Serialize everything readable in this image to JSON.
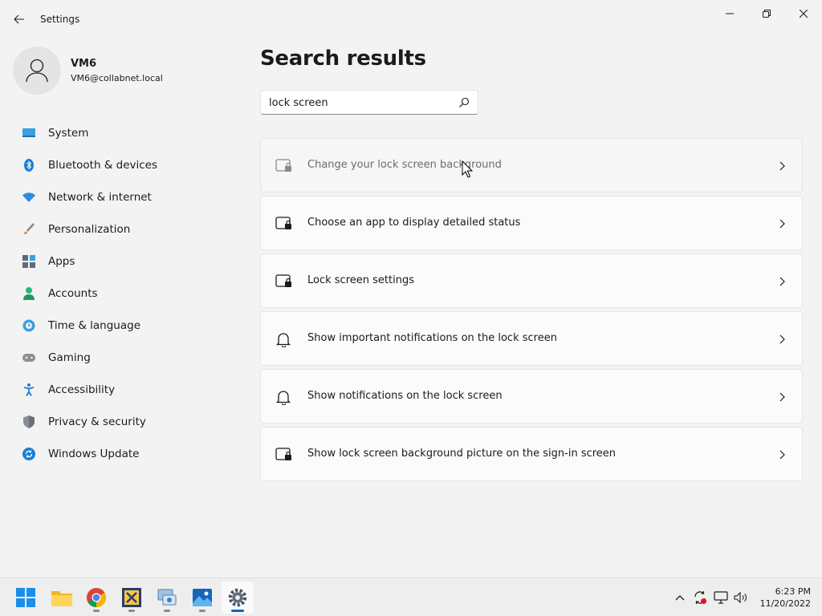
{
  "window": {
    "title": "Settings"
  },
  "profile": {
    "name": "VM6",
    "email": "VM6@collabnet.local"
  },
  "sidebar": {
    "items": [
      {
        "label": "System",
        "icon": "system-icon"
      },
      {
        "label": "Bluetooth & devices",
        "icon": "bluetooth-icon"
      },
      {
        "label": "Network & internet",
        "icon": "wifi-icon"
      },
      {
        "label": "Personalization",
        "icon": "brush-icon"
      },
      {
        "label": "Apps",
        "icon": "apps-icon"
      },
      {
        "label": "Accounts",
        "icon": "accounts-icon"
      },
      {
        "label": "Time & language",
        "icon": "clock-globe-icon"
      },
      {
        "label": "Gaming",
        "icon": "gamepad-icon"
      },
      {
        "label": "Accessibility",
        "icon": "accessibility-icon"
      },
      {
        "label": "Privacy & security",
        "icon": "shield-icon"
      },
      {
        "label": "Windows Update",
        "icon": "update-icon"
      }
    ]
  },
  "main": {
    "title": "Search results",
    "search": {
      "value": "lock screen"
    },
    "results": [
      {
        "label": "Change your lock screen background",
        "icon": "lock-screen-icon"
      },
      {
        "label": "Choose an app to display detailed status",
        "icon": "lock-screen-icon"
      },
      {
        "label": "Lock screen settings",
        "icon": "lock-screen-icon"
      },
      {
        "label": "Show important notifications on the lock screen",
        "icon": "bell-icon"
      },
      {
        "label": "Show notifications on the lock screen",
        "icon": "bell-icon"
      },
      {
        "label": "Show lock screen background picture on the sign-in screen",
        "icon": "lock-screen-icon"
      }
    ]
  },
  "taskbar": {
    "apps": [
      "start-icon",
      "file-explorer-icon",
      "chrome-icon",
      "visual-studio-icon",
      "remote-desktop-icon",
      "photos-icon",
      "settings-icon"
    ],
    "clock": {
      "time": "6:23 PM",
      "date": "11/20/2022"
    }
  },
  "colors": {
    "accent": "#0067c0",
    "background": "#f3f3f3",
    "card": "#fbfbfb"
  }
}
